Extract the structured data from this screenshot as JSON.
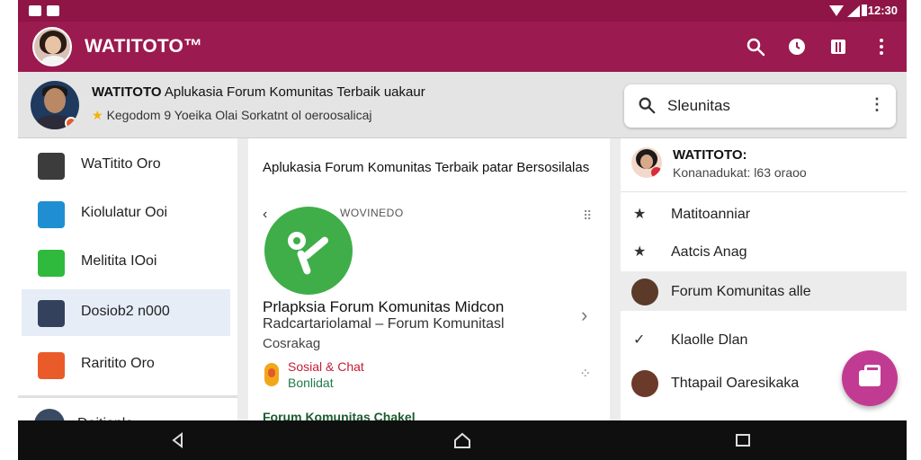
{
  "statusbar": {
    "time": "12:30"
  },
  "appbar": {
    "title": "WATITOTO™"
  },
  "header": {
    "title_bold": "WATITOTO",
    "title_rest": "Aplukasia Forum Komunitas Terbaik uakaur",
    "subtitle": "Kegodom 9 Yoeika Olai Sorkatnt ol oeroosalicaj"
  },
  "search": {
    "value": "Sleunitas"
  },
  "sidebar": {
    "items": [
      {
        "label": "WaTitito Oro",
        "color": "#3c3c3c"
      },
      {
        "label": "Kiolulatur Ooi",
        "color": "#1f8fd1"
      },
      {
        "label": "Melitita IOoi",
        "color": "#2fba3d"
      },
      {
        "label": "Dosiob2 n000",
        "color": "#33415c"
      },
      {
        "label": "Raritito Oro",
        "color": "#ea5b2a"
      }
    ],
    "bottom_label": "Doitionlo"
  },
  "center": {
    "title": "Aplukasia Forum Komunitas Terbaik patar Bersosilalas",
    "top_label": "WOVINEDO",
    "name": "Prlapksia Forum Komunitas Midcon",
    "desc1": "Radcartariolamal – Forum Komunitasl",
    "desc2": "Cosrakag",
    "category": "Sosial & Chat",
    "category2": "Bonlidat",
    "footer": "Forum Komunitas Chakel"
  },
  "right": {
    "title": "WATITOTO:",
    "subtitle": "Konanadukat: l63 oraoo",
    "rows": [
      {
        "label": "Matitoanniar",
        "icon": "star"
      },
      {
        "label": "Aatcis Anag",
        "icon": "star"
      },
      {
        "label": "Forum Komunitas alle",
        "icon": "avatar"
      },
      {
        "label": "Klaolle Dlan",
        "icon": "check"
      },
      {
        "label": "Thtapail Oaresikaka",
        "icon": "avatar"
      }
    ]
  },
  "colors": {
    "brand": "#9b1a4f",
    "fab": "#c13b93",
    "logo": "#3fae49"
  }
}
